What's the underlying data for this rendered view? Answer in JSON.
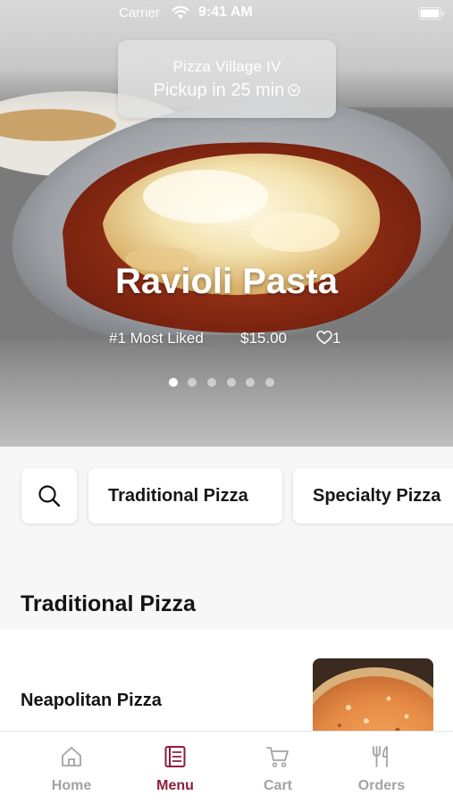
{
  "status_bar": {
    "carrier": "Carrier",
    "time": "9:41 AM"
  },
  "location": {
    "store_name": "Pizza Village IV",
    "pickup": "Pickup in 25 min"
  },
  "featured": {
    "title": "Ravioli Pasta",
    "rank": "#1 Most Liked",
    "price": "$15.00",
    "likes": "1",
    "slide_count": 6,
    "active_slide": 1
  },
  "categories": {
    "search_icon": "search-icon",
    "items": [
      "Traditional Pizza",
      "Specialty Pizza"
    ]
  },
  "section": {
    "title": "Traditional Pizza"
  },
  "menu_items": [
    {
      "name": "Neapolitan Pizza"
    }
  ],
  "tabbar": {
    "tabs": [
      {
        "label": "Home",
        "icon": "home-icon"
      },
      {
        "label": "Menu",
        "icon": "menu-book-icon"
      },
      {
        "label": "Cart",
        "icon": "cart-icon"
      },
      {
        "label": "Orders",
        "icon": "fork-knife-icon"
      }
    ],
    "active": "Menu",
    "active_color": "#8e1d3a",
    "inactive_color": "#a3a3a3"
  }
}
